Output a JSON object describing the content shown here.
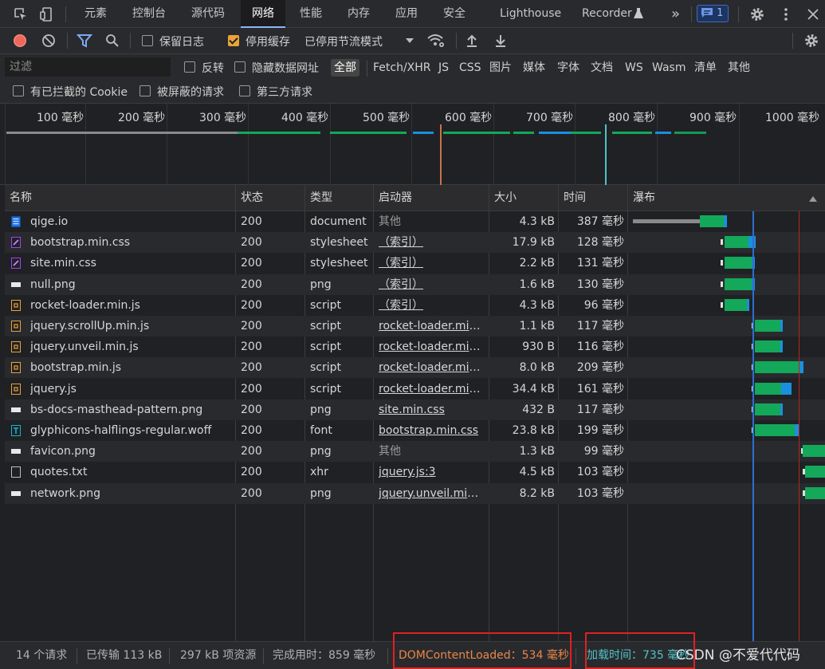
{
  "tabs": [
    "元素",
    "控制台",
    "源代码",
    "网络",
    "性能",
    "内存",
    "应用",
    "安全",
    "Lighthouse",
    "Recorder"
  ],
  "active_tab": "网络",
  "issues_count": "1",
  "toolbar": {
    "preserve_log": "保留日志",
    "disable_cache": "停用缓存",
    "throttling": "已停用节流模式"
  },
  "filter": {
    "placeholder": "过滤",
    "invert": "反转",
    "hide_data_urls": "隐藏数据网址",
    "types": [
      "全部",
      "Fetch/XHR",
      "JS",
      "CSS",
      "图片",
      "媒体",
      "字体",
      "文档",
      "WS",
      "Wasm",
      "清单",
      "其他"
    ],
    "selected_type": "全部",
    "blocked_cookies": "有已拦截的 Cookie",
    "blocked_requests": "被屏蔽的请求",
    "third_party": "第三方请求"
  },
  "overview_ticks": [
    "100 毫秒",
    "200 毫秒",
    "300 毫秒",
    "400 毫秒",
    "500 毫秒",
    "600 毫秒",
    "700 毫秒",
    "800 毫秒",
    "900 毫秒",
    "1000 毫秒"
  ],
  "columns": {
    "name": "名称",
    "status": "状态",
    "type": "类型",
    "initiator": "启动器",
    "size": "大小",
    "time": "时间",
    "waterfall": "瀑布"
  },
  "requests": [
    {
      "name": "qige.io",
      "icon": "document-icon",
      "status": "200",
      "type": "document",
      "initiator": "其他",
      "initiator_link": false,
      "size": "4.3 kB",
      "time": "387 毫秒"
    },
    {
      "name": "bootstrap.min.css",
      "icon": "stylesheet-icon",
      "status": "200",
      "type": "stylesheet",
      "initiator": "（索引）",
      "initiator_link": true,
      "size": "17.9 kB",
      "time": "128 毫秒"
    },
    {
      "name": "site.min.css",
      "icon": "stylesheet-icon",
      "status": "200",
      "type": "stylesheet",
      "initiator": "（索引）",
      "initiator_link": true,
      "size": "2.2 kB",
      "time": "131 毫秒"
    },
    {
      "name": "null.png",
      "icon": "image-icon",
      "status": "200",
      "type": "png",
      "initiator": "（索引）",
      "initiator_link": true,
      "size": "1.6 kB",
      "time": "130 毫秒"
    },
    {
      "name": "rocket-loader.min.js",
      "icon": "script-icon",
      "status": "200",
      "type": "script",
      "initiator": "（索引）",
      "initiator_link": true,
      "size": "4.3 kB",
      "time": "96 毫秒"
    },
    {
      "name": "jquery.scrollUp.min.js",
      "icon": "script-icon",
      "status": "200",
      "type": "script",
      "initiator": "rocket-loader.min.js",
      "initiator_link": true,
      "size": "1.1 kB",
      "time": "117 毫秒"
    },
    {
      "name": "jquery.unveil.min.js",
      "icon": "script-icon",
      "status": "200",
      "type": "script",
      "initiator": "rocket-loader.min.js",
      "initiator_link": true,
      "size": "930 B",
      "time": "116 毫秒"
    },
    {
      "name": "bootstrap.min.js",
      "icon": "script-icon",
      "status": "200",
      "type": "script",
      "initiator": "rocket-loader.min.js",
      "initiator_link": true,
      "size": "8.0 kB",
      "time": "209 毫秒"
    },
    {
      "name": "jquery.js",
      "icon": "script-icon",
      "status": "200",
      "type": "script",
      "initiator": "rocket-loader.min.js",
      "initiator_link": true,
      "size": "34.4 kB",
      "time": "161 毫秒"
    },
    {
      "name": "bs-docs-masthead-pattern.png",
      "icon": "image-icon",
      "status": "200",
      "type": "png",
      "initiator": "site.min.css",
      "initiator_link": true,
      "size": "432 B",
      "time": "117 毫秒"
    },
    {
      "name": "glyphicons-halflings-regular.woff",
      "icon": "font-icon",
      "status": "200",
      "type": "font",
      "initiator": "bootstrap.min.css",
      "initiator_link": true,
      "size": "23.8 kB",
      "time": "199 毫秒"
    },
    {
      "name": "favicon.png",
      "icon": "image-icon",
      "status": "200",
      "type": "png",
      "initiator": "其他",
      "initiator_link": false,
      "size": "1.3 kB",
      "time": "99 毫秒"
    },
    {
      "name": "quotes.txt",
      "icon": "file-icon",
      "status": "200",
      "type": "xhr",
      "initiator": "jquery.js:3",
      "initiator_link": true,
      "size": "4.5 kB",
      "time": "103 毫秒"
    },
    {
      "name": "network.png",
      "icon": "image-icon",
      "status": "200",
      "type": "png",
      "initiator": "jquery.unveil.min.js",
      "initiator_link": true,
      "size": "8.2 kB",
      "time": "103 毫秒"
    }
  ],
  "status": {
    "requests": "14 个请求",
    "transferred": "已传输 113 kB",
    "resources": "297 kB 项资源",
    "finish": "完成用时：859 毫秒",
    "dom_content_loaded": "DOMContentLoaded：534 毫秒",
    "load": "加载时间：735 毫秒"
  },
  "watermark": "CSDN @不爱代代码",
  "colors": {
    "accent": "#8ab4f8",
    "dcl": "#e8874a",
    "load": "#4fc3c9",
    "highlight": "#e02020",
    "wait_green": "#13a85a",
    "download_blue": "#1a8fe0"
  }
}
